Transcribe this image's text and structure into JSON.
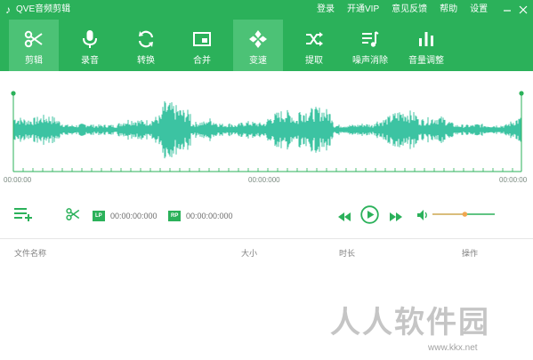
{
  "app": {
    "title": "QVE音频剪辑"
  },
  "titlebar": {
    "menu": [
      "登录",
      "开通VIP",
      "意见反馈",
      "帮助",
      "设置"
    ],
    "controls": [
      "minimize-icon",
      "close-icon"
    ]
  },
  "toolbar": {
    "tools": [
      {
        "label": "剪辑",
        "icon": "scissors-icon",
        "active": true
      },
      {
        "label": "录音",
        "icon": "microphone-icon",
        "active": false
      },
      {
        "label": "转换",
        "icon": "convert-icon",
        "active": false
      },
      {
        "label": "合并",
        "icon": "merge-icon",
        "active": false
      },
      {
        "label": "变速",
        "icon": "speed-icon",
        "active": true
      },
      {
        "label": "提取",
        "icon": "extract-icon",
        "active": false
      },
      {
        "label": "噪声消除",
        "icon": "noise-removal-icon",
        "active": false
      },
      {
        "label": "音量调整",
        "icon": "volume-adjust-icon",
        "active": false
      }
    ]
  },
  "waveform": {
    "time_start": "00:00:00",
    "time_mid": "00:00:000",
    "time_end": "00:00:00",
    "color": "#3cc3a2"
  },
  "controls": {
    "lp_label": "LP",
    "lp_time": "00:00:00:000",
    "rp_label": "RP",
    "rp_time": "00:00:00:000",
    "volume_level": 0.52
  },
  "filelist": {
    "columns": [
      "文件名称",
      "大小",
      "时长",
      "操作"
    ]
  },
  "watermark": {
    "text": "人人软件园",
    "url": "www.kkx.net"
  },
  "colors": {
    "brand": "#2bb15a",
    "active_tab": "#4cc276",
    "wave": "#3cc3a2"
  }
}
